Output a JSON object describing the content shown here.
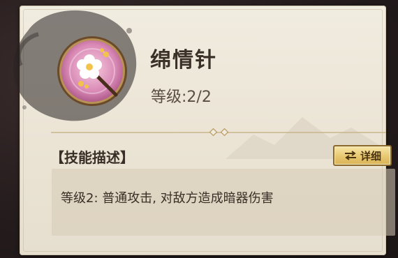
{
  "skill": {
    "name": "绵情针",
    "level_text": "等级:2/2",
    "icon": "plum-blossom-needle-icon"
  },
  "description": {
    "section_title": "【技能描述】",
    "detail_button_label": "详细",
    "detail_button_icon": "swap-arrows-icon",
    "text": "等级2: 普通攻击, 对敌方造成暗器伤害"
  },
  "colors": {
    "panel_bg": "#ebe4d5",
    "accent_gold": "#d9b257",
    "icon_pink": "#e9a6c8",
    "text_dark": "#3a2f26"
  }
}
